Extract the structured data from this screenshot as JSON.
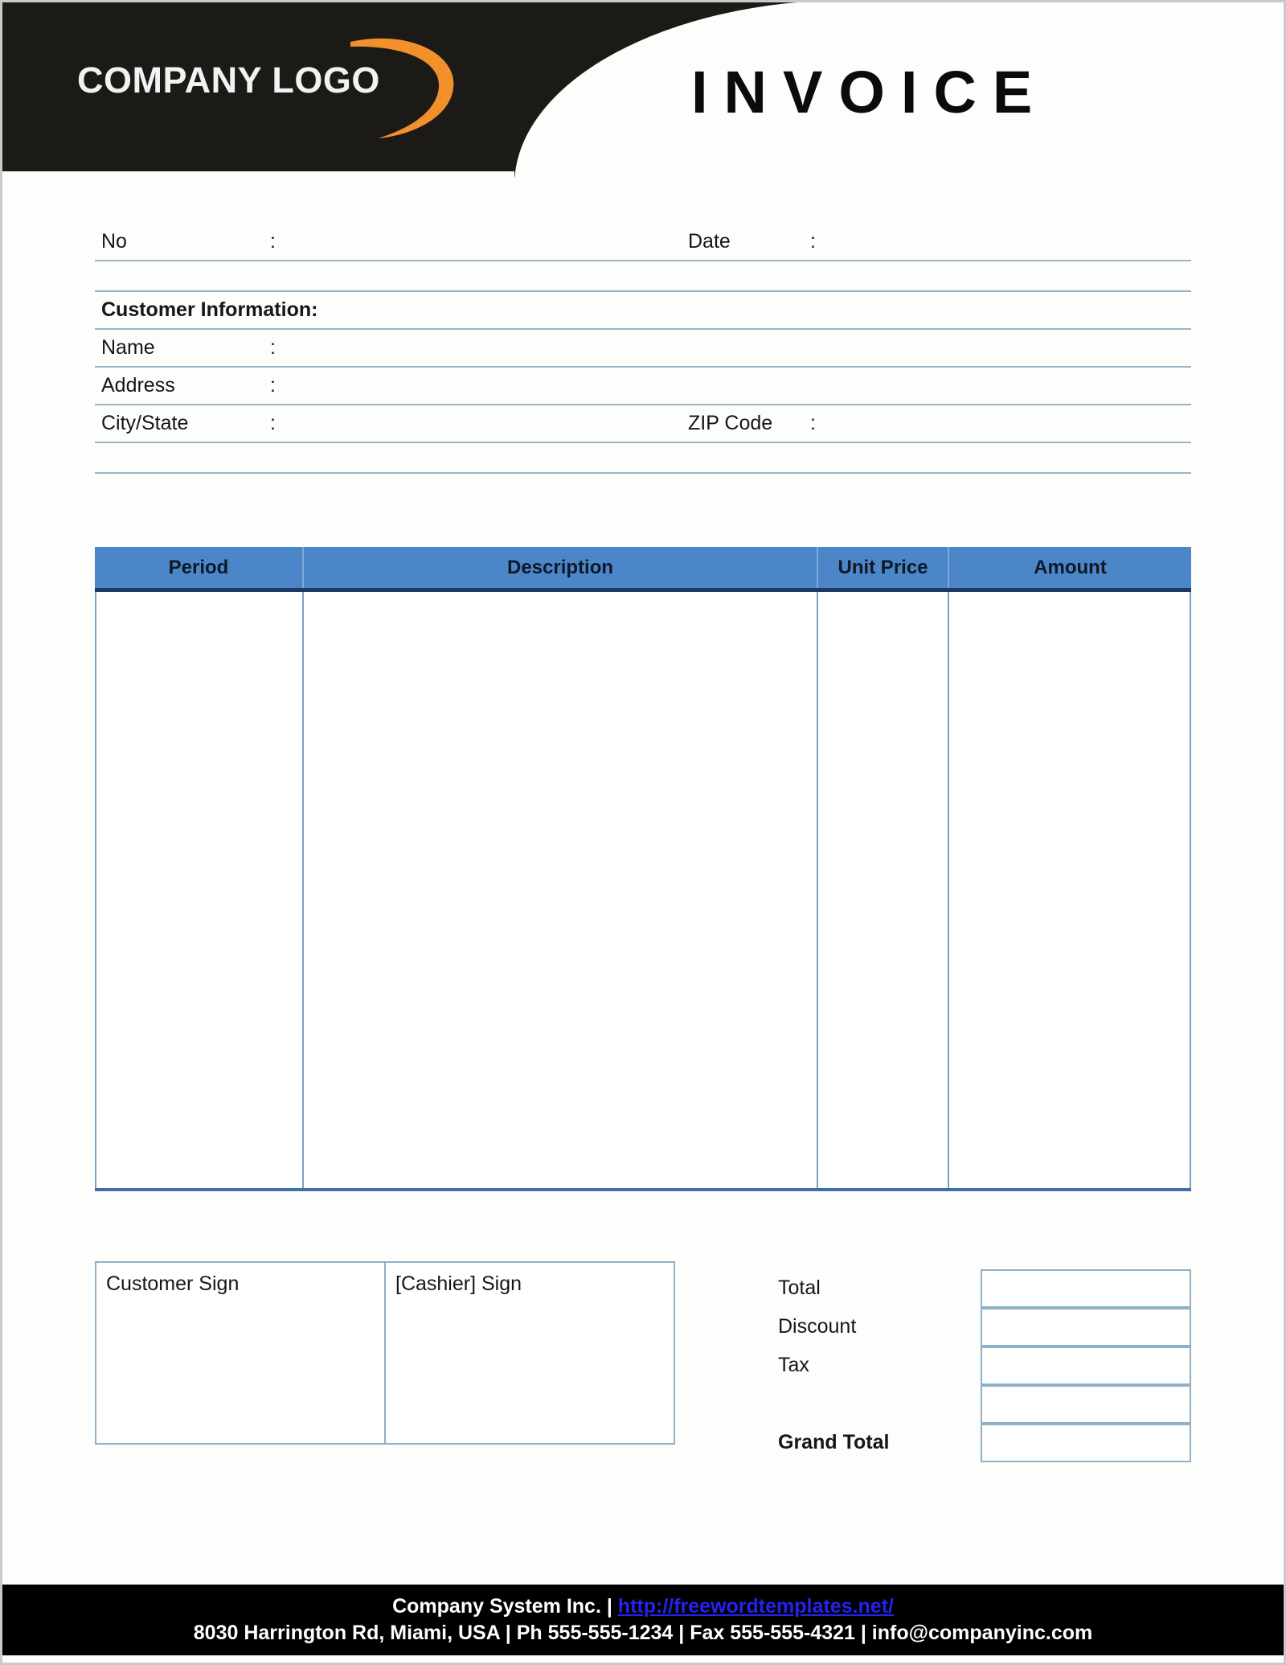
{
  "document": {
    "title": "INVOICE"
  },
  "header": {
    "logo_text": "COMPANY LOGO",
    "logo_swoosh_icon": "orange-swoosh-icon",
    "title": "INVOICE",
    "background_color": "#1c1a17",
    "swoosh_color": "#f2902b"
  },
  "meta_fields": {
    "no_label": "No",
    "no_colon": ":",
    "no_value": "",
    "date_label": "Date",
    "date_colon": ":",
    "date_value": ""
  },
  "customer": {
    "section_title": "Customer Information:",
    "name_label": "Name",
    "name_colon": ":",
    "name_value": "",
    "address_label": "Address",
    "address_colon": ":",
    "address_value": "",
    "city_state_label": "City/State",
    "city_state_colon": ":",
    "city_state_value": "",
    "zip_label": "ZIP Code",
    "zip_colon": ":",
    "zip_value": ""
  },
  "items_table": {
    "columns": [
      {
        "label": "Period"
      },
      {
        "label": "Description"
      },
      {
        "label": "Unit Price"
      },
      {
        "label": "Amount"
      }
    ],
    "rows": [],
    "header_bg_color": "#4a86c8",
    "header_rule_color": "#1f3864",
    "cell_border_color": "#7ba0c4"
  },
  "signatures": {
    "customer_sign_label": "Customer Sign",
    "cashier_sign_label": "[Cashier] Sign",
    "customer_sign_value": "",
    "cashier_sign_value": ""
  },
  "totals": {
    "rows": [
      {
        "label": "Total",
        "value": "",
        "bold": false
      },
      {
        "label": "Discount",
        "value": "",
        "bold": false
      },
      {
        "label": "Tax",
        "value": "",
        "bold": false
      },
      {
        "label": "",
        "value": "",
        "bold": false
      },
      {
        "label": "Grand Total",
        "value": "",
        "bold": true
      }
    ]
  },
  "footer": {
    "company": "Company System Inc. | ",
    "url": "http://freewordtemplates.net/",
    "address_line": "8030 Harrington Rd, Miami, USA | Ph 555-555-1234 | Fax 555-555-4321 | info@companyinc.com",
    "background_color": "#000000",
    "link_color": "#2323ef"
  }
}
